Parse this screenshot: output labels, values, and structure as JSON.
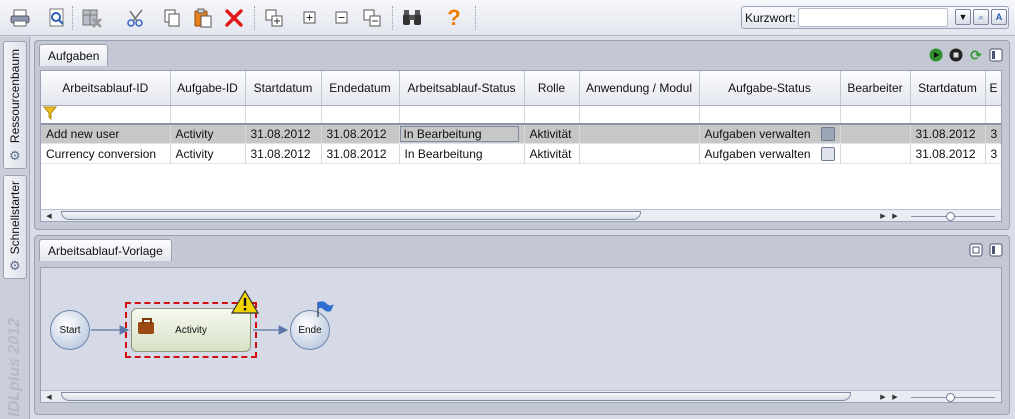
{
  "toolbar": {
    "buttons": [
      "print-icon",
      "preview-icon",
      "delete-column-icon",
      "cut-icon",
      "copy-icon",
      "paste-icon",
      "delete-icon",
      "expand-all-icon",
      "expand-icon",
      "collapse-icon",
      "collapse-all-icon",
      "binoculars-icon",
      "help-icon"
    ],
    "keyword_label": "Kurzwort:",
    "keyword_value": "",
    "help_glyph": "?"
  },
  "side_tabs": {
    "resource_tree": "Ressourcenbaum",
    "quickstart": "Schnellstarter",
    "brand": "IDLplus 2012"
  },
  "tasks_panel": {
    "title": "Aufgaben",
    "columns": [
      "Arbeitsablauf-ID",
      "Aufgabe-ID",
      "Startdatum",
      "Endedatum",
      "Arbeitsablauf-Status",
      "Rolle",
      "Anwendung / Modul",
      "Aufgabe-Status",
      "Bearbeiter",
      "Startdatum",
      "E"
    ],
    "rows": [
      {
        "workflow_id": "Add new user",
        "task_id": "Activity",
        "start": "31.08.2012",
        "end": "31.08.2012",
        "workflow_status": "In Bearbeitung",
        "role": "Aktivität",
        "module": "",
        "task_status": "Aufgaben verwalten",
        "editor": "",
        "start2": "31.08.2012",
        "e": "3",
        "selected": true
      },
      {
        "workflow_id": "Currency conversion",
        "task_id": "Activity",
        "start": "31.08.2012",
        "end": "31.08.2012",
        "workflow_status": "In Bearbeitung",
        "role": "Aktivität",
        "module": "",
        "task_status": "Aufgaben verwalten",
        "editor": "",
        "start2": "31.08.2012",
        "e": "3",
        "selected": false
      }
    ]
  },
  "template_panel": {
    "title": "Arbeitsablauf-Vorlage",
    "start_label": "Start",
    "activity_label": "Activity",
    "end_label": "Ende"
  },
  "colors": {
    "accent": "#2f8f2f",
    "warning": "#f3d400",
    "selection_frame": "#d01010",
    "delete_icon": "#e01818",
    "help_icon": "#f07b00"
  }
}
